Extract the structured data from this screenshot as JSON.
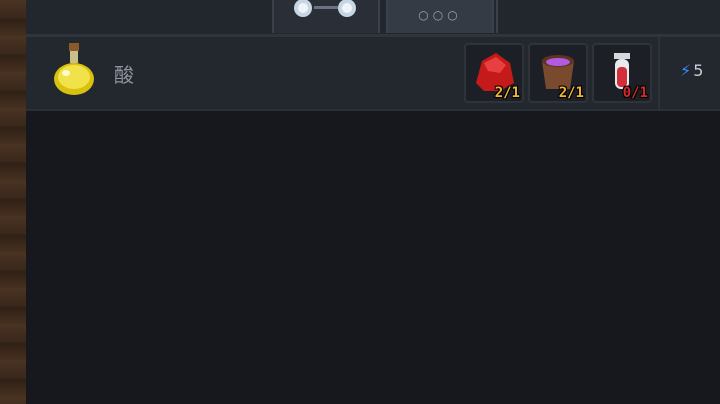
{
  "recipe": {
    "name": "酸",
    "ingredients": [
      {
        "name": "red-crystal-icon",
        "count": "2/1",
        "status": "ok"
      },
      {
        "name": "purple-potion-bowl-icon",
        "count": "2/1",
        "status": "ok"
      },
      {
        "name": "red-vial-icon",
        "count": "0/1",
        "status": "short"
      }
    ],
    "energy_cost": "5"
  },
  "tabs": {
    "more_label": "○○○"
  },
  "colors": {
    "count_ok": "#f0b43a",
    "count_short": "#d22a2a",
    "energy": "#3a8cff"
  }
}
